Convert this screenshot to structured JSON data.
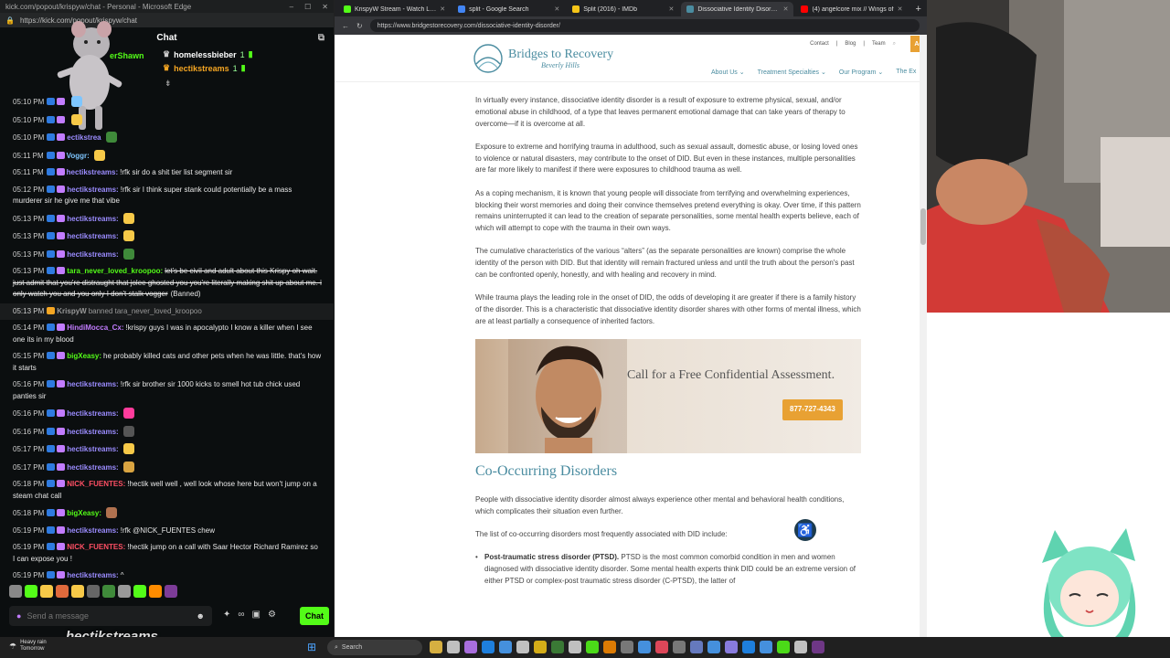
{
  "chat_window": {
    "title": "kick.com/popout/krispyw/chat - Personal - Microsoft Edge",
    "url": "https://kick.com/popout/krispyw/chat",
    "header": "Chat",
    "pinned_partial": "erShawn",
    "gifters": [
      {
        "name": "homelessbieber",
        "count": "1",
        "color": "#ffffff"
      },
      {
        "name": "hectikstreams",
        "count": "1",
        "color": "#f5a623"
      }
    ],
    "messages": [
      {
        "time": "05:10 PM",
        "user": "",
        "color": "#ffffff",
        "text": "",
        "emote": "#7ec6ff"
      },
      {
        "time": "05:10 PM",
        "user": "",
        "color": "#9b8cff",
        "text": "",
        "emote": "#f7c948"
      },
      {
        "time": "05:10 PM",
        "user": "ectikstrea",
        "color": "#9b8cff",
        "text": "",
        "emote": "#3f8a3a"
      },
      {
        "time": "05:11 PM",
        "user": "Voggr:",
        "color": "#7ec6ff",
        "text": "",
        "emote": "#f7c948"
      },
      {
        "time": "05:11 PM",
        "user": "hectikstreams:",
        "color": "#9b8cff",
        "text": "!rfk sir do a shit tier list segment sir",
        "emote": ""
      },
      {
        "time": "05:12 PM",
        "user": "hectikstreams:",
        "color": "#9b8cff",
        "text": "!rfk sir I think super stank could potentially be a mass murderer sir he give me that vibe",
        "emote": ""
      },
      {
        "time": "05:13 PM",
        "user": "hectikstreams:",
        "color": "#9b8cff",
        "text": "",
        "emote": "#f7c948"
      },
      {
        "time": "05:13 PM",
        "user": "hectikstreams:",
        "color": "#9b8cff",
        "text": "",
        "emote": "#f7c948"
      },
      {
        "time": "05:13 PM",
        "user": "hectikstreams:",
        "color": "#9b8cff",
        "text": "",
        "emote": "#3f8a3a"
      },
      {
        "time": "05:13 PM",
        "user": "tara_never_loved_kroopoo:",
        "color": "#53fc18",
        "text": "let's be civil and adult about this Krispy oh wait. just admit that you're distraught that jolee ghosted you you're literally making shit up about me. i only watch you and you only I don't stalk vogger",
        "note": "(Banned)",
        "strike": true,
        "emote": ""
      },
      {
        "time": "05:13 PM",
        "user": "KrispyW",
        "color": "#999999",
        "text": "banned tara_never_loved_kroopoo",
        "system": true,
        "emote": ""
      },
      {
        "time": "05:14 PM",
        "user": "HindiMocca_Cx:",
        "color": "#c27cff",
        "text": "!krispy guys I was in apocalypto I know a killer when I see one its in my blood",
        "emote": ""
      },
      {
        "time": "05:15 PM",
        "user": "bigXeasy:",
        "color": "#53fc18",
        "text": "he probably killed cats and other pets when he was little. that's how it starts",
        "emote": ""
      },
      {
        "time": "05:16 PM",
        "user": "hectikstreams:",
        "color": "#9b8cff",
        "text": "!rfk sir brother sir 1000 kicks to smell hot tub chick used panties sir",
        "emote": ""
      },
      {
        "time": "05:16 PM",
        "user": "hectikstreams:",
        "color": "#9b8cff",
        "text": "",
        "emote": "#ff3c9c"
      },
      {
        "time": "05:16 PM",
        "user": "hectikstreams:",
        "color": "#9b8cff",
        "text": "",
        "emote": "#555555"
      },
      {
        "time": "05:17 PM",
        "user": "hectikstreams:",
        "color": "#9b8cff",
        "text": "",
        "emote": "#f7c948"
      },
      {
        "time": "05:17 PM",
        "user": "hectikstreams:",
        "color": "#9b8cff",
        "text": "",
        "emote": "#d9a441"
      },
      {
        "time": "05:18 PM",
        "user": "NICK_FUENTES:",
        "color": "#ff4f64",
        "text": "!hectik well well , well look whose here but won't jump on a steam chat call",
        "emote": ""
      },
      {
        "time": "05:18 PM",
        "user": "bigXeasy:",
        "color": "#53fc18",
        "text": "",
        "emote": "#b0714f"
      },
      {
        "time": "05:19 PM",
        "user": "hectikstreams:",
        "color": "#9b8cff",
        "text": "!rfk @NICK_FUENTES chew",
        "emote": ""
      },
      {
        "time": "05:19 PM",
        "user": "NICK_FUENTES:",
        "color": "#ff4f64",
        "text": "!hectik jump on a call with Saar Hector Richard Ramirez so I can expose you !",
        "emote": ""
      },
      {
        "time": "05:19 PM",
        "user": "hectikstreams:",
        "color": "#9b8cff",
        "text": "^",
        "emote": ""
      }
    ],
    "input_placeholder": "Send a message",
    "send_label": "Chat",
    "overlay_text": "hectikstreams",
    "emote_colors": [
      "#888",
      "#53fc18",
      "#f7c948",
      "#e06a3c",
      "#f7c948",
      "#666",
      "#3f8a3a",
      "#999",
      "#53fc18",
      "#ff8c00",
      "#7d3c98"
    ]
  },
  "browser": {
    "tabs": [
      {
        "label": "KrispyW Stream - Watch Live on K",
        "color": "#53fc18",
        "active": false
      },
      {
        "label": "split - Google Search",
        "color": "#4285f4",
        "active": false
      },
      {
        "label": "Split (2016) - IMDb",
        "color": "#f5c518",
        "active": false
      },
      {
        "label": "Dissociative Identity Disorder - Br",
        "color": "#4a8ca0",
        "active": true
      },
      {
        "label": "(4) angelcore mix // Wings of",
        "color": "#ff0000",
        "active": false
      }
    ],
    "url": "https://www.bridgestorecovery.com/dissociative-identity-disorder/"
  },
  "site": {
    "logo_name": "Bridges to Recovery",
    "logo_sub": "Beverly Hills",
    "util_links": [
      "Contact",
      "Blog",
      "Team"
    ],
    "admit_label": "Ad",
    "nav": [
      "About Us",
      "Treatment Specialties",
      "Our Program",
      "The Ex"
    ],
    "paragraphs": [
      "In virtually every instance, dissociative identity disorder is a result of exposure to extreme physical, sexual, and/or emotional abuse in childhood, of a type that leaves permanent emotional damage that can take years of therapy to overcome—if it is overcome at all.",
      "Exposure to extreme and horrifying trauma in adulthood, such as sexual assault, domestic abuse, or losing loved ones to violence or natural disasters, may contribute to the onset of DID. But even in these instances, multiple personalities are far more likely to manifest if there were exposures to childhood trauma as well.",
      "As a coping mechanism, it is known that young people will dissociate from terrifying and overwhelming experiences, blocking their worst memories and doing their convince themselves pretend everything is okay. Over time, if this pattern remains uninterrupted it can lead to the creation of separate personalities, some mental health experts believe, each of which will attempt to cope with the trauma in their own ways.",
      "The cumulative characteristics of the various “alters” (as the separate personalities are known) comprise the whole identity of the person with DID. But that identity will remain fractured unless and until the truth about the person's past can be confronted openly, honestly, and with healing and recovery in mind.",
      "While trauma plays the leading role in the onset of DID, the odds of developing it are greater if there is a family history of the disorder. This is a characteristic that dissociative identity disorder shares with other forms of mental illness, which are at least partially a consequence of inherited factors."
    ],
    "cta_title": "Call for a Free Confidential Assessment.",
    "cta_phone": "877-727-4343",
    "heading": "Co-Occurring Disorders",
    "paragraphs2": [
      "People with dissociative identity disorder almost always experience other mental and behavioral health conditions, which complicates their situation even further.",
      "The list of co-occurring disorders most frequently associated with DID include:"
    ],
    "bullet_title": "Post-traumatic stress disorder (PTSD).",
    "bullet_text": "PTSD is the most common comorbid condition in men and women diagnosed with dissociative identity disorder. Some mental health experts think DID could be an extreme version of either PTSD or complex-post traumatic stress disorder (C-PTSD), the latter of"
  },
  "taskbar": {
    "weather_line1": "Heavy rain",
    "weather_line2": "Tomorrow",
    "search_label": "Search",
    "icon_colors": [
      "#f7c948",
      "#ddd",
      "#c27cff",
      "#1e90ff",
      "#4ca4ff",
      "#ddd",
      "#f5c518",
      "#3f8a3a",
      "#ddd",
      "#53fc18",
      "#ff8c00",
      "#888",
      "#4ca4ff",
      "#ff4f64",
      "#888",
      "#7289da",
      "#4ca4ff",
      "#9b8cff",
      "#1e90ff",
      "#4ca4ff",
      "#53fc18",
      "#ddd",
      "#7d3c98"
    ]
  }
}
